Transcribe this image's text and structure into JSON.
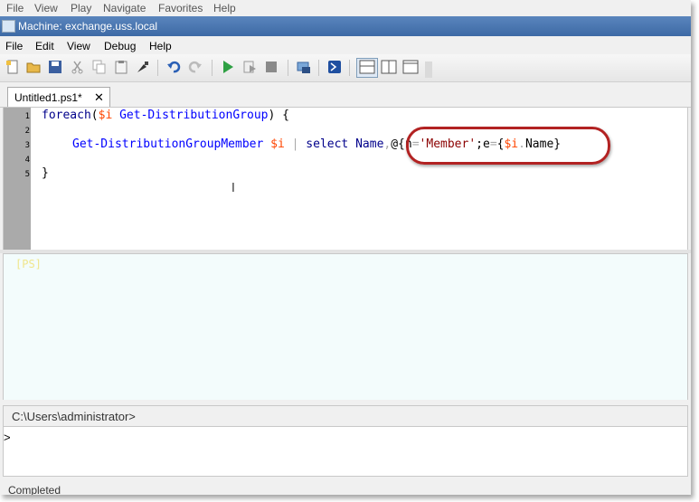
{
  "outer_menu": {
    "items": [
      "File",
      "View",
      "Play",
      "Navigate",
      "Favorites",
      "Help"
    ]
  },
  "window": {
    "title": "Machine: exchange.uss.local"
  },
  "menu": {
    "items": [
      "File",
      "Edit",
      "View",
      "Debug",
      "Help"
    ]
  },
  "toolbar": {
    "icons": [
      "new-file-icon",
      "open-folder-icon",
      "save-icon",
      "cut-icon",
      "copy-icon",
      "paste-icon",
      "clear-icon",
      "undo-icon",
      "redo-icon",
      "run-icon",
      "run-selection-icon",
      "stop-icon",
      "remote-session-icon",
      "powershell-icon",
      "layout-top-icon",
      "layout-side-icon",
      "layout-full-icon"
    ]
  },
  "tab": {
    "label": "Untitled1.ps1*",
    "close": "✕"
  },
  "editor": {
    "line_numbers": [
      "1",
      "2",
      "3",
      "4",
      "5"
    ],
    "line1": {
      "kw": "foreach",
      "p1": "(",
      "var": "$i",
      "sp": " ",
      "cmd": "Get-DistributionGroup",
      "p2": ") {"
    },
    "line3": {
      "cmd": "Get-DistributionGroupMember",
      "sp1": " ",
      "var1": "$i",
      "pipe": " | ",
      "sel": "select",
      "name": " Name",
      "comma": ",",
      "at": "@{",
      "n": "n",
      "eq1": "=",
      "str": "'Member'",
      "semi": ";",
      "e": "e",
      "eq2": "=",
      "brace": "{",
      "var2": "$i",
      "dot": ".",
      "prop": "Name",
      "close": "}"
    },
    "line5": "}"
  },
  "output": {
    "prompt": "[PS]"
  },
  "command_pane": {
    "path": "C:\\Users\\administrator>"
  },
  "input": {
    "prompt": ">"
  },
  "status": {
    "text": "Completed"
  },
  "colors": {
    "highlight": "#b22222",
    "keyword": "#00008b",
    "variable": "#ff4500",
    "cmdlet": "#0000ff",
    "string": "#8b0000"
  }
}
